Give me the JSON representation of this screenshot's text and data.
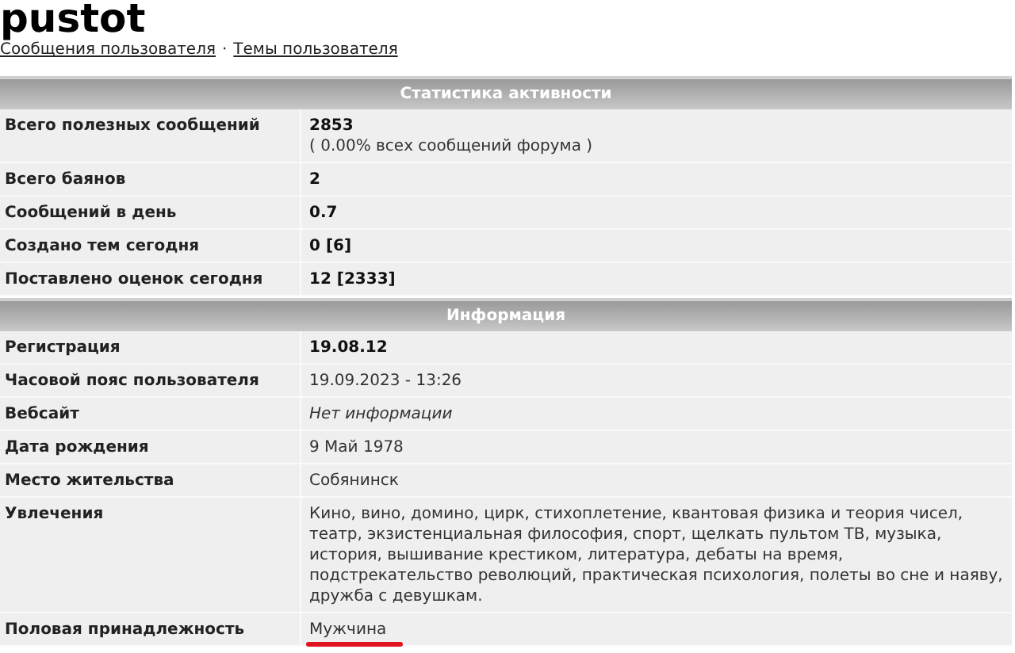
{
  "title": "pustot",
  "links": [
    "Сообщения пользователя",
    "Темы пользователя"
  ],
  "link_separator": "·",
  "sections": [
    {
      "heading": "Статистика активности",
      "rows": [
        {
          "label": "Всего полезных сообщений",
          "value": "2853",
          "note": "( 0.00% всех сообщений форума )"
        },
        {
          "label": "Всего баянов",
          "value": "2"
        },
        {
          "label": "Сообщений в день",
          "value": "0.7"
        },
        {
          "label": "Создано тем сегодня",
          "value": "0 [6]"
        },
        {
          "label": "Поставлено оценок сегодня",
          "value": "12 [2333]"
        }
      ]
    },
    {
      "heading": "Информация",
      "rows": [
        {
          "label": "Регистрация",
          "value": "19.08.12"
        },
        {
          "label": "Часовой пояс пользователя",
          "value": "19.09.2023 - 13:26"
        },
        {
          "label": "Вебсайт",
          "value": "Нет информации",
          "missing": true
        },
        {
          "label": "Дата рождения",
          "value": "9 Май 1978"
        },
        {
          "label": "Место жительства",
          "value": "Собянинск"
        },
        {
          "label": "Увлечения",
          "value": "Кино, вино, домино, цирк, стихоплетение, квантовая физика и теория чисел, театр, экзистенциальная философия, спорт, щелкать пультом ТВ, музыка, история, вышивание крестиком, литература, дебаты на время, подстрекательство революций, практическая психология, полеты во сне и наяву, дружба с девушкам."
        },
        {
          "label": "Половая принадлежность",
          "value": "Мужчина",
          "underlined": true
        }
      ]
    }
  ]
}
